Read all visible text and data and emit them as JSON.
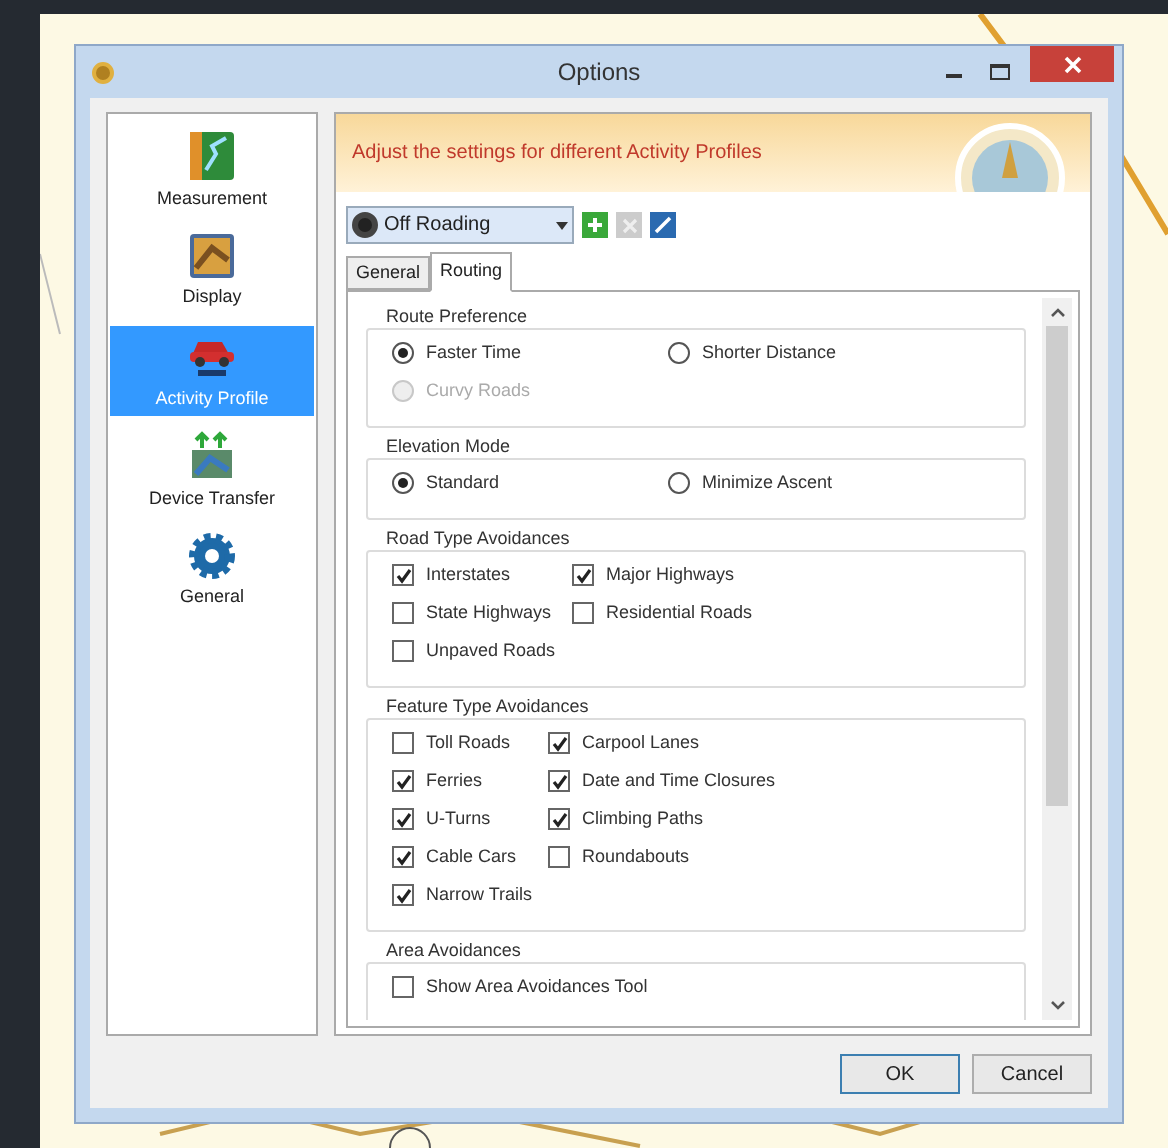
{
  "window": {
    "title": "Options"
  },
  "sidebar": {
    "items": [
      {
        "label": "Measurement",
        "kind": "ruler",
        "selected": false
      },
      {
        "label": "Display",
        "kind": "display",
        "selected": false
      },
      {
        "label": "Activity Profile",
        "kind": "car",
        "selected": true
      },
      {
        "label": "Device Transfer",
        "kind": "transfer",
        "selected": false
      },
      {
        "label": "General",
        "kind": "gear",
        "selected": false
      }
    ]
  },
  "banner": {
    "text": "Adjust the settings for different Activity Profiles"
  },
  "profile": {
    "value": "Off Roading"
  },
  "tabs": [
    {
      "label": "General",
      "selected": false
    },
    {
      "label": "Routing",
      "selected": true
    }
  ],
  "sections": [
    {
      "title": "Route Preference",
      "kind": "radio",
      "items": [
        {
          "label": "Faster Time",
          "selected": true,
          "disabled": false
        },
        {
          "label": "Shorter Distance",
          "selected": false,
          "disabled": false
        },
        {
          "label": "Curvy Roads",
          "selected": false,
          "disabled": true
        }
      ]
    },
    {
      "title": "Elevation Mode",
      "kind": "radio",
      "items": [
        {
          "label": "Standard",
          "selected": true,
          "disabled": false
        },
        {
          "label": "Minimize Ascent",
          "selected": false,
          "disabled": false
        }
      ]
    },
    {
      "title": "Road Type Avoidances",
      "kind": "check",
      "items": [
        {
          "label": "Interstates",
          "checked": true
        },
        {
          "label": "Major Highways",
          "checked": true
        },
        {
          "label": "State Highways",
          "checked": false
        },
        {
          "label": "Residential Roads",
          "checked": false
        },
        {
          "label": "Unpaved Roads",
          "checked": false
        }
      ]
    },
    {
      "title": "Feature Type Avoidances",
      "kind": "check",
      "items": [
        {
          "label": "Toll Roads",
          "checked": false
        },
        {
          "label": "Carpool Lanes",
          "checked": true
        },
        {
          "label": "Ferries",
          "checked": true
        },
        {
          "label": "Date and Time Closures",
          "checked": true
        },
        {
          "label": "U-Turns",
          "checked": true
        },
        {
          "label": "Climbing Paths",
          "checked": true
        },
        {
          "label": "Cable Cars",
          "checked": true
        },
        {
          "label": "Roundabouts",
          "checked": false
        },
        {
          "label": "Narrow Trails",
          "checked": true
        }
      ]
    },
    {
      "title": "Area Avoidances",
      "kind": "check",
      "items": [
        {
          "label": "Show Area Avoidances Tool",
          "checked": false
        }
      ]
    }
  ],
  "buttons": [
    "OK",
    "Cancel"
  ]
}
